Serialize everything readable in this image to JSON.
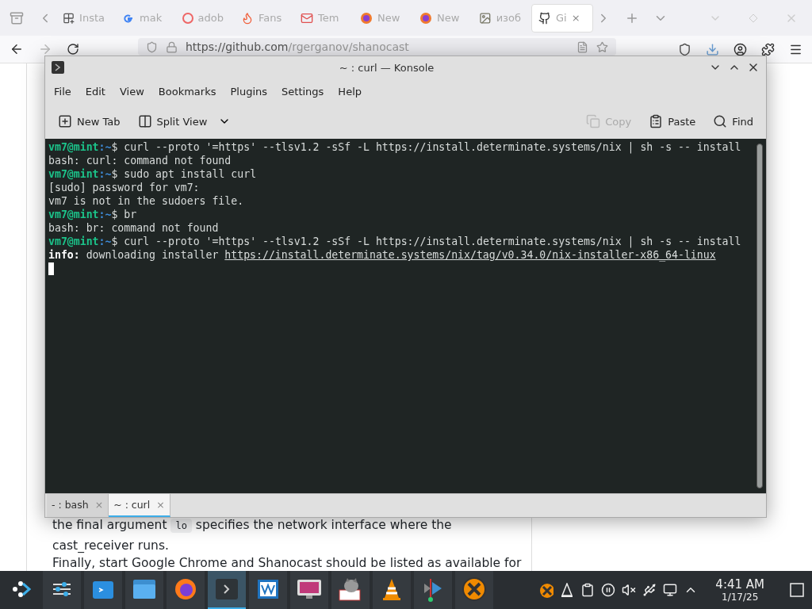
{
  "browser": {
    "tabs": [
      {
        "label": "Insta",
        "kind": "apps",
        "selected": false
      },
      {
        "label": "mak",
        "kind": "g",
        "selected": false
      },
      {
        "label": "adob",
        "kind": "ring",
        "selected": false
      },
      {
        "label": "Fans",
        "kind": "flame",
        "selected": false
      },
      {
        "label": "Tem",
        "kind": "mail",
        "selected": false
      },
      {
        "label": "New",
        "kind": "fox",
        "selected": false
      },
      {
        "label": "New",
        "kind": "fox",
        "selected": false
      },
      {
        "label": "изоб",
        "kind": "image",
        "selected": false
      },
      {
        "label": "Gi",
        "kind": "github",
        "selected": true,
        "close": "×"
      }
    ],
    "url": {
      "host": "https://github.com",
      "path": "/rgerganov/shanocast"
    },
    "page": {
      "paragraphs": [
        [
          {
            "text": "the final argument ",
            "kind": "text"
          },
          {
            "text": "lo",
            "kind": "code"
          },
          {
            "text": " specifies the network interface where the cast_receiver runs.",
            "kind": "text"
          }
        ],
        [
          {
            "text": "Finally, start Google Chrome and Shanocast should be listed as available for",
            "kind": "text"
          }
        ]
      ]
    }
  },
  "konsole": {
    "title": "~ : curl — Konsole",
    "menu": [
      "File",
      "Edit",
      "View",
      "Bookmarks",
      "Plugins",
      "Settings",
      "Help"
    ],
    "toolbar_left": [
      {
        "label": "New Tab",
        "kind": "newtab"
      },
      {
        "label": "Split View",
        "kind": "split"
      }
    ],
    "toolbar_right": [
      {
        "label": "Copy",
        "kind": "copy",
        "disabled": true
      },
      {
        "label": "Paste",
        "kind": "paste",
        "disabled": false
      },
      {
        "label": "Find",
        "kind": "find",
        "disabled": false
      }
    ],
    "lines": [
      {
        "kind": "prompt",
        "user": "vm7@mint",
        "sep": ":",
        "path": "~",
        "sign": "$",
        "command": "curl --proto '=https' --tlsv1.2 -sSf -L https://install.determinate.systems/nix | sh -s -- install"
      },
      {
        "kind": "output",
        "text": "bash: curl: command not found"
      },
      {
        "kind": "prompt",
        "user": "vm7@mint",
        "sep": ":",
        "path": "~",
        "sign": "$",
        "command": "sudo apt install curl"
      },
      {
        "kind": "output",
        "text": "[sudo] password for vm7:"
      },
      {
        "kind": "output",
        "text": "vm7 is not in the sudoers file."
      },
      {
        "kind": "prompt",
        "user": "vm7@mint",
        "sep": ":",
        "path": "~",
        "sign": "$",
        "command": "br"
      },
      {
        "kind": "output",
        "text": "bash: br: command not found"
      },
      {
        "kind": "prompt",
        "user": "vm7@mint",
        "sep": ":",
        "path": "~",
        "sign": "$",
        "command": "curl --proto '=https' --tlsv1.2 -sSf -L https://install.determinate.systems/nix | sh -s -- install"
      },
      {
        "kind": "info",
        "label": "info:",
        "text": "downloading installer",
        "link": "https://install.determinate.systems/nix/tag/v0.34.0/nix-installer-x86_64-linux"
      },
      {
        "kind": "cursor"
      }
    ],
    "tabs": [
      {
        "label": "- : bash",
        "close": "×",
        "selected": false
      },
      {
        "label": "~ : curl",
        "close": "×",
        "selected": true
      }
    ]
  },
  "taskbar": {
    "apps": [
      {
        "kind": "launcher",
        "selected": false
      },
      {
        "kind": "sliders",
        "selected": false
      },
      {
        "kind": "blue",
        "selected": false
      },
      {
        "kind": "folder",
        "selected": false
      },
      {
        "kind": "firefox",
        "selected": false
      },
      {
        "kind": "terminal",
        "selected": true
      },
      {
        "kind": "monitor",
        "selected": false
      },
      {
        "kind": "screen",
        "selected": false
      },
      {
        "kind": "cat",
        "selected": false
      },
      {
        "kind": "cone",
        "selected": false
      },
      {
        "kind": "editor",
        "selected": false
      },
      {
        "kind": "xcircle",
        "selected": false
      }
    ],
    "tray": [
      {
        "kind": "xcircle"
      },
      {
        "kind": "cone"
      },
      {
        "kind": "clipboard"
      },
      {
        "kind": "pause"
      },
      {
        "kind": "mute"
      },
      {
        "kind": "usb"
      },
      {
        "kind": "network"
      },
      {
        "kind": "caret"
      }
    ],
    "time": "4:41 AM",
    "date": "1/17/25"
  }
}
